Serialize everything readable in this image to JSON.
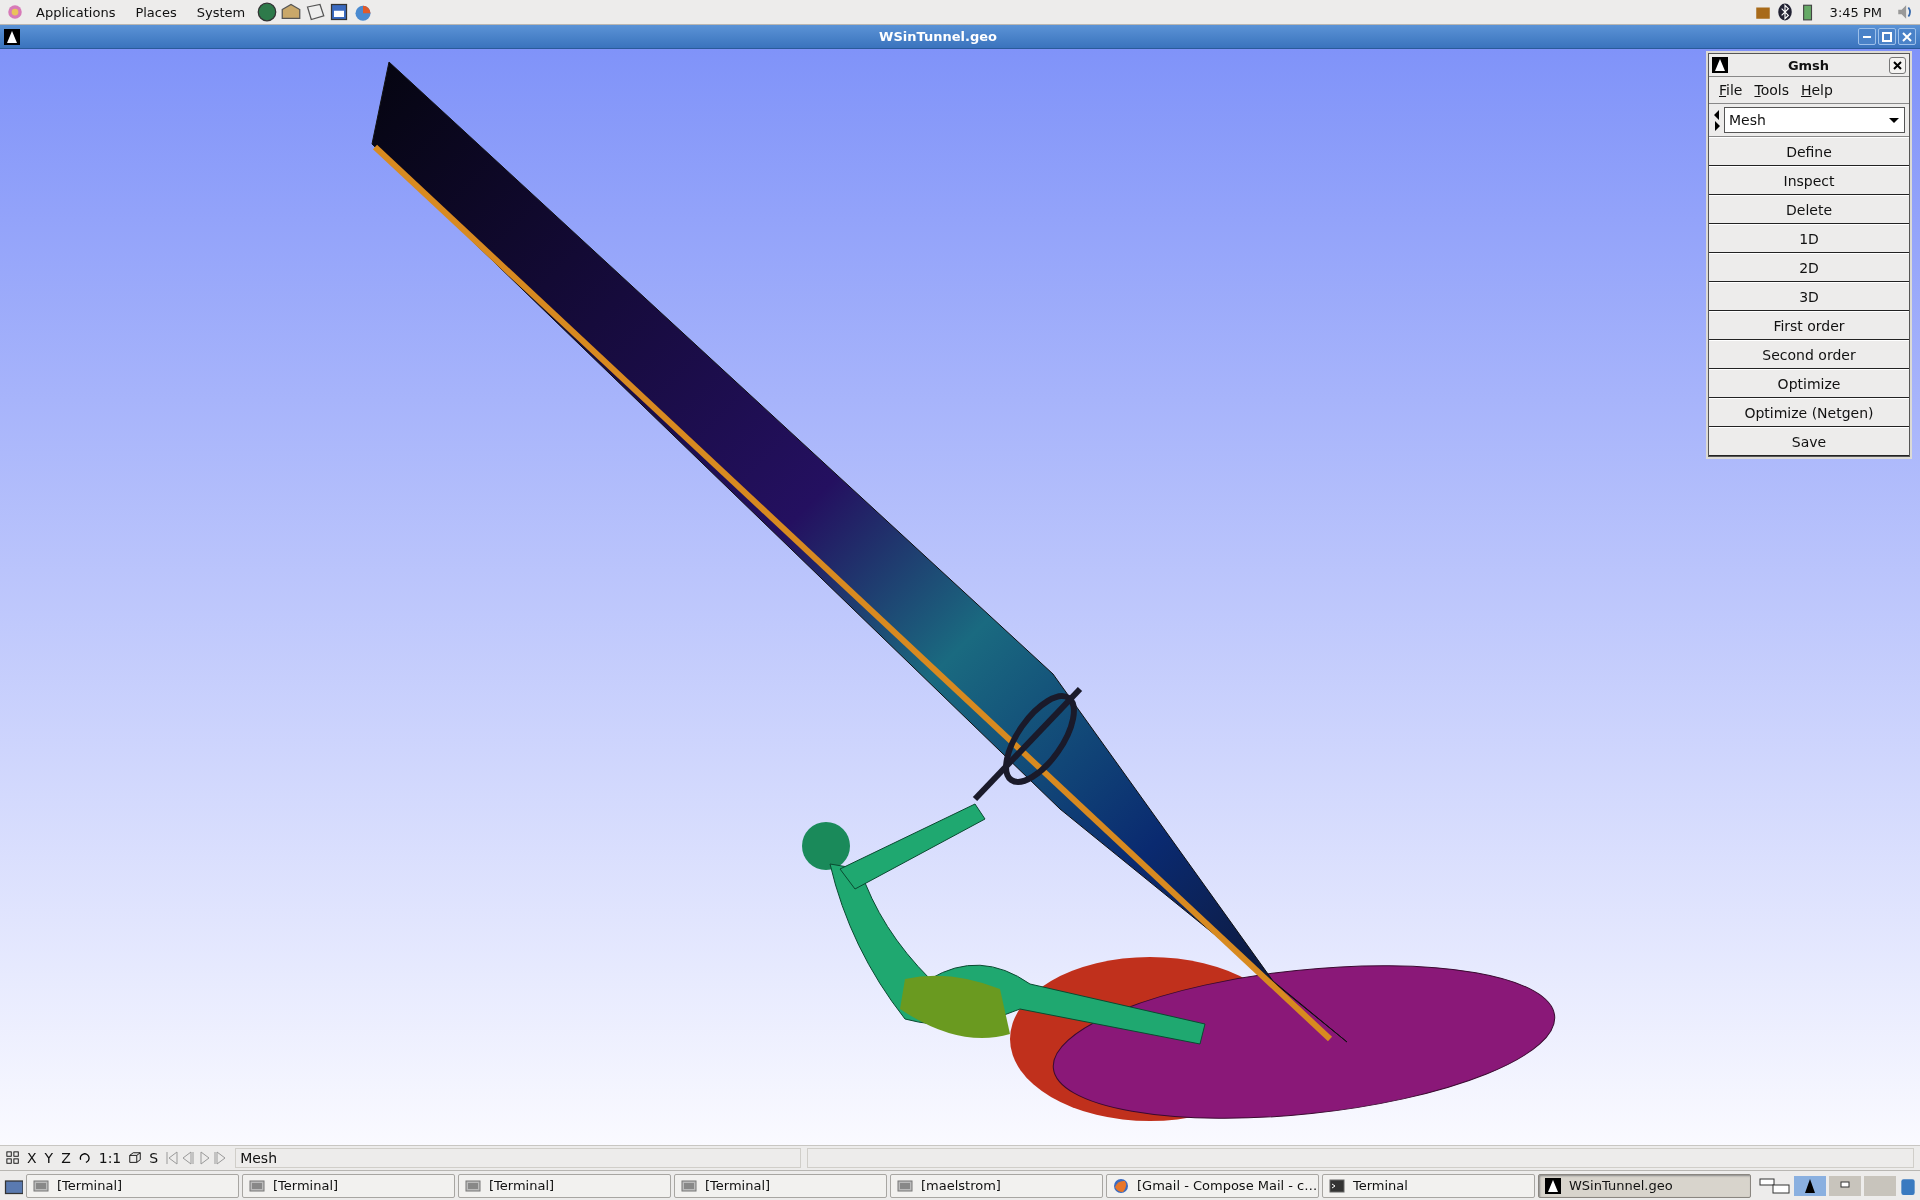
{
  "top_panel": {
    "menus": [
      "Applications",
      "Places",
      "System"
    ],
    "clock": "3:45 PM"
  },
  "window": {
    "title": "WSinTunnel.geo"
  },
  "gmsh_panel": {
    "title": "Gmsh",
    "menu": [
      "File",
      "Tools",
      "Help"
    ],
    "module": "Mesh",
    "buttons": [
      "Define",
      "Inspect",
      "Delete",
      "1D",
      "2D",
      "3D",
      "First order",
      "Second order",
      "Optimize",
      "Optimize (Netgen)",
      "Save"
    ]
  },
  "status_bar": {
    "buttons": [
      "X",
      "Y",
      "Z",
      "1:1",
      "S"
    ],
    "message": "Mesh"
  },
  "taskbar": [
    {
      "label": "[Terminal]",
      "kind": "terminal",
      "selected": false
    },
    {
      "label": "[Terminal]",
      "kind": "terminal",
      "selected": false
    },
    {
      "label": "[Terminal]",
      "kind": "terminal",
      "selected": false
    },
    {
      "label": "[Terminal]",
      "kind": "terminal",
      "selected": false
    },
    {
      "label": "[maelstrom]",
      "kind": "terminal",
      "selected": false
    },
    {
      "label": "[Gmail - Compose Mail - c…",
      "kind": "browser",
      "selected": false
    },
    {
      "label": "Terminal",
      "kind": "console",
      "selected": false
    },
    {
      "label": "WSinTunnel.geo",
      "kind": "gmsh",
      "selected": true
    }
  ]
}
